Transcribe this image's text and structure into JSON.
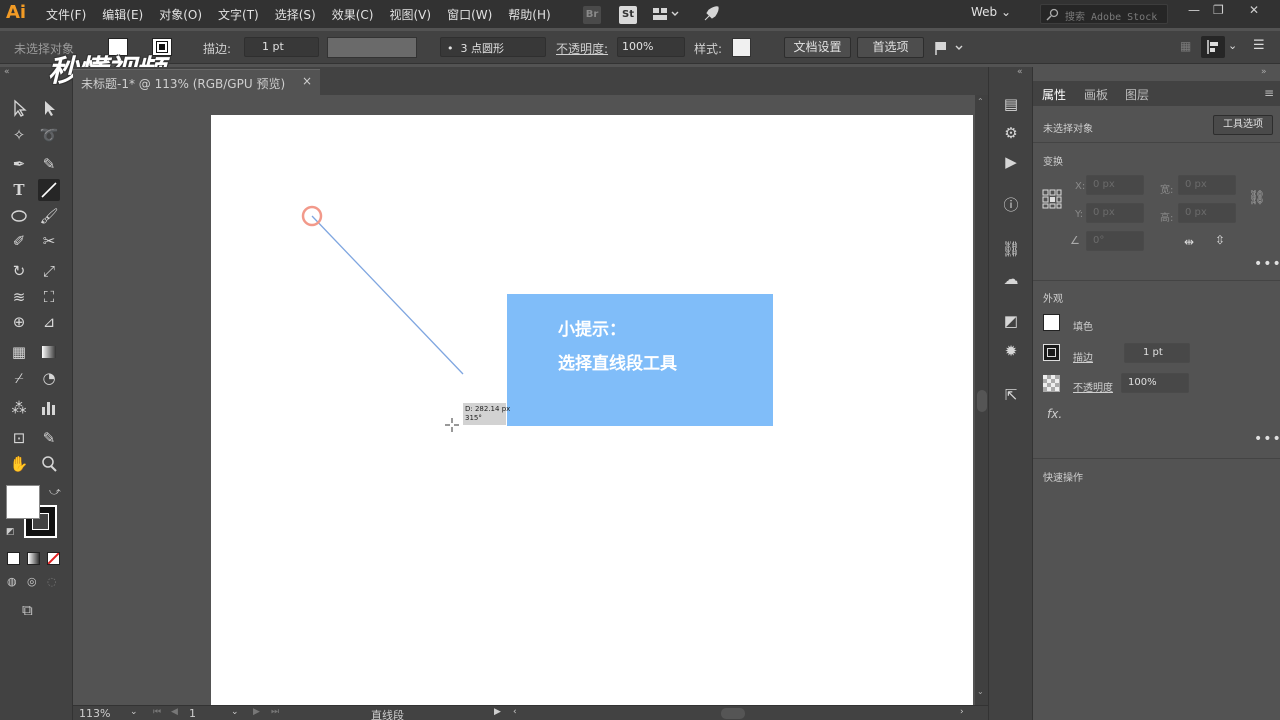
{
  "app": {
    "logo": "Ai",
    "menus": [
      "文件(F)",
      "编辑(E)",
      "对象(O)",
      "文字(T)",
      "选择(S)",
      "效果(C)",
      "视图(V)",
      "窗口(W)",
      "帮助(H)"
    ],
    "br_label": "Br",
    "st_label": "St",
    "workspace": "Web",
    "search_placeholder": "搜索 Adobe Stock"
  },
  "control_bar": {
    "selection_status": "未选择对象",
    "stroke_label": "描边:",
    "stroke_value": "1 pt",
    "brush_value": "3 点圆形",
    "opacity_label": "不透明度:",
    "opacity_value": "100%",
    "style_label": "样式:",
    "doc_settings": "文档设置",
    "preferences": "首选项"
  },
  "document": {
    "tab_title": "未标题-1* @ 113% (RGB/GPU 预览)",
    "tab_close": "×",
    "measure_distance": "D: 282.14 px",
    "measure_angle": "315°"
  },
  "tip": {
    "line1": "小提示：",
    "line2": "选择直线段工具"
  },
  "status_bar": {
    "zoom": "113%",
    "page": "1",
    "tool_name": "直线段"
  },
  "watermark": {
    "text": "秒懂视频"
  },
  "right_panel": {
    "tabs": [
      "属性",
      "画板",
      "图层"
    ],
    "no_selection": "未选择对象",
    "tool_options": "工具选项",
    "transform_title": "变换",
    "x_label": "X:",
    "x_value": "0 px",
    "y_label": "Y:",
    "y_value": "0 px",
    "w_label": "宽:",
    "w_value": "0 px",
    "h_label": "高:",
    "h_value": "0 px",
    "angle_value": "0°",
    "appearance_title": "外观",
    "fill_label": "填色",
    "stroke_label": "描边",
    "stroke_value": "1 pt",
    "opacity_label": "不透明度",
    "opacity_value": "100%",
    "fx_label": "fx.",
    "quick_actions_title": "快速操作"
  },
  "colors": {
    "accent_orange": "#f29b25",
    "tip_blue": "#80bdf9",
    "line_blue": "#7fa6e0",
    "anchor_red": "#f2998a"
  }
}
